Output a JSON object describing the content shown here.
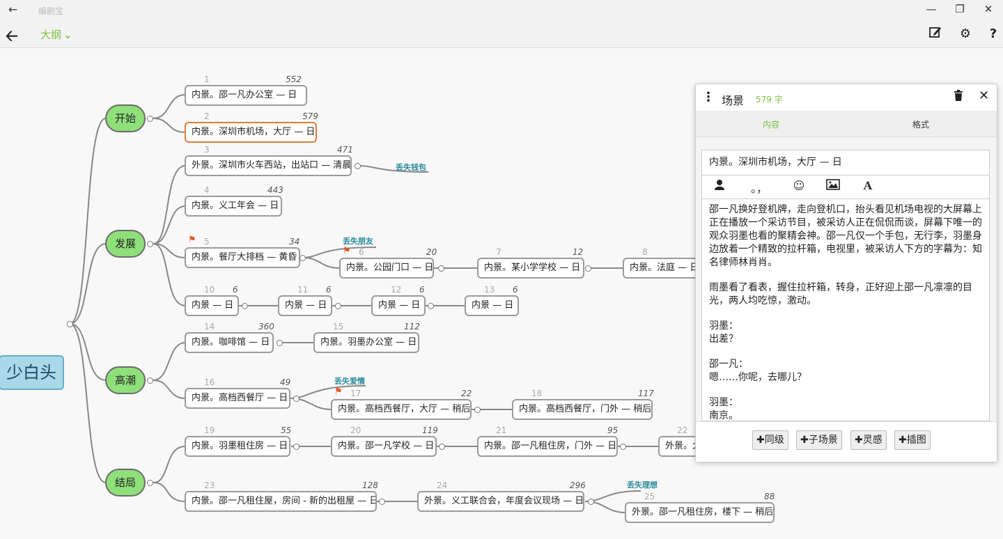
{
  "titlebar": {
    "title": "编剧宝",
    "back_icon": "arrow-left-icon",
    "minimize": "—",
    "restore": "❐",
    "close": "✕"
  },
  "toolbar": {
    "outline_label": "大纲",
    "back_icon": "arrow-left-bold-icon",
    "edit_icon": "edit-icon",
    "settings_icon": "gear-icon",
    "help": "?"
  },
  "mindmap": {
    "root": "少白头",
    "acts": [
      {
        "label": "开始"
      },
      {
        "label": "发展"
      },
      {
        "label": "高潮"
      },
      {
        "label": "结局"
      }
    ],
    "scenes": [
      {
        "num": "1",
        "words": "552",
        "text": "内景。邵一凡办公室 — 日"
      },
      {
        "num": "2",
        "words": "579",
        "text": "内景。深圳市机场，大厅 — 日"
      },
      {
        "num": "3",
        "words": "471",
        "text": "外景。深圳市火车西站，出站口 — 清晨"
      },
      {
        "num": "4",
        "words": "443",
        "text": "内景。义工年会 — 日"
      },
      {
        "num": "5",
        "words": "34",
        "text": "内景。餐厅大排档 — 黄昏"
      },
      {
        "num": "6",
        "words": "20",
        "text": "内景。公园门口 — 日"
      },
      {
        "num": "7",
        "words": "12",
        "text": "内景。某小学学校 — 日"
      },
      {
        "num": "8",
        "words": "",
        "text": "内景。法庭 — 日"
      },
      {
        "num": "10",
        "words": "6",
        "text": "内景 — 日"
      },
      {
        "num": "11",
        "words": "6",
        "text": "内景 — 日"
      },
      {
        "num": "12",
        "words": "6",
        "text": "内景 — 日"
      },
      {
        "num": "13",
        "words": "6",
        "text": "内景 — 日"
      },
      {
        "num": "14",
        "words": "360",
        "text": "内景。咖啡馆 — 日"
      },
      {
        "num": "15",
        "words": "112",
        "text": "内景。羽墨办公室 — 日"
      },
      {
        "num": "16",
        "words": "49",
        "text": "内景。高档西餐厅 — 日"
      },
      {
        "num": "17",
        "words": "22",
        "text": "内景。高档西餐厅，大厅 — 稍后"
      },
      {
        "num": "18",
        "words": "117",
        "text": "内景。高档西餐厅，门外 — 稍后"
      },
      {
        "num": "19",
        "words": "55",
        "text": "内景。羽墨租住房 — 日"
      },
      {
        "num": "20",
        "words": "119",
        "text": "内景。邵一凡学校 — 日"
      },
      {
        "num": "21",
        "words": "95",
        "text": "内景。邵一凡租住房，门外 — 日"
      },
      {
        "num": "22",
        "words": "",
        "text": "外景。大"
      },
      {
        "num": "23",
        "words": "128",
        "text": "内景。邵一凡租住屋，房间 - 新的出租屋 — 日"
      },
      {
        "num": "24",
        "words": "296",
        "text": "外景。义工联合会，年度会议现场 — 日"
      },
      {
        "num": "25",
        "words": "88",
        "text": "外景。邵一凡租住房，楼下 — 稍后"
      }
    ],
    "notes": [
      "丢失钱包",
      "丢失朋友",
      "丢失爱情",
      "丢失理想"
    ],
    "flag_icon": "flag-icon"
  },
  "panel": {
    "title": "场景",
    "count": "579 字",
    "menu_icon": "kebab-icon",
    "trash_icon": "trash-icon",
    "close_icon": "close-icon",
    "tabs": [
      "内容",
      "格式"
    ],
    "heading": "内景。深圳市机场，大厅 — 日",
    "fmt": {
      "person_icon": "person-icon",
      "punct": "。，",
      "emoji_icon": "emoji-icon",
      "image_icon": "image-icon",
      "font_icon": "font-icon"
    },
    "paragraphs": [
      "邵一凡换好登机牌，走向登机口，抬头看见机场电视的大屏幕上正在播放一个采访节目，被采访人正在侃侃而谈，屏幕下唯一的观众羽墨也看的聚精会神。邵一凡仅一个手包，无行李，羽墨身边放着一个精致的拉杆箱，电视里，被采访人下方的字幕为：知名律师林肖肖。",
      "雨墨看了看表，握住拉杆箱，转身，正好迎上邵一凡凛凛的目光，两人均吃惊，激动。",
      "羽墨：",
      "出差？",
      "邵一凡：",
      "嗯……你呢，去哪儿？",
      "羽墨：",
      "南京。"
    ],
    "buttons": [
      "同级",
      "子场景",
      "灵感",
      "插图"
    ],
    "plus": "✚"
  }
}
